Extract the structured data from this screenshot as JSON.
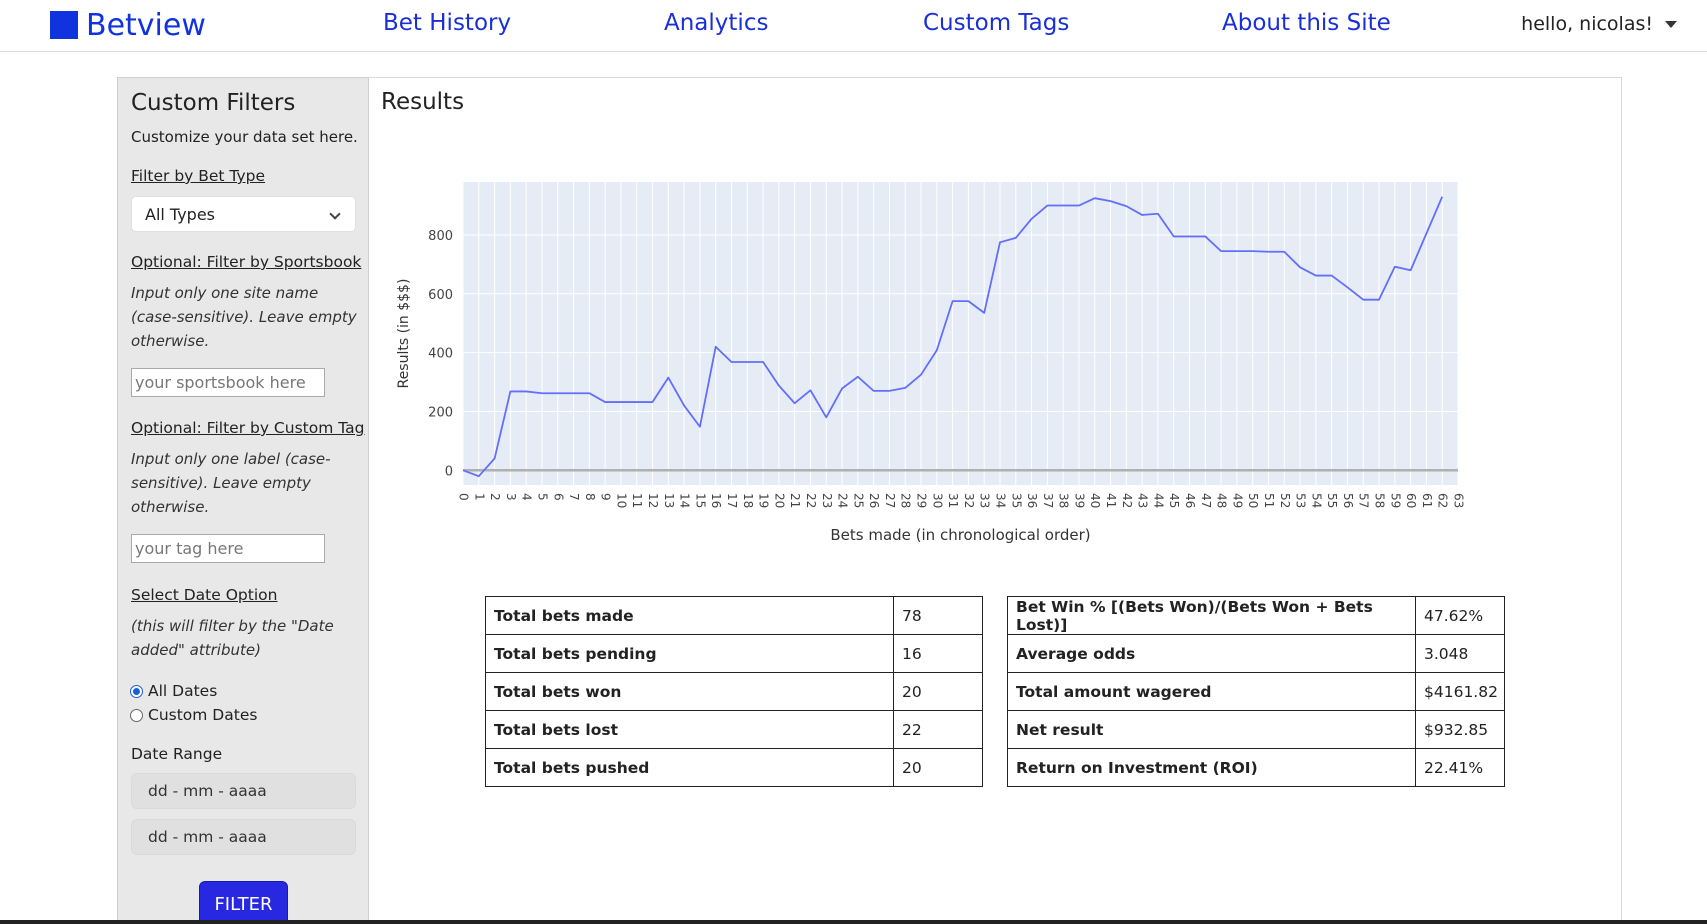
{
  "navbar": {
    "brand": "Betview",
    "links": [
      "Bet History",
      "Analytics",
      "Custom Tags",
      "About this Site"
    ],
    "user": "hello, nicolas!",
    "colors": {
      "brand": "#1133dd",
      "link": "#1a2fd6"
    }
  },
  "sidebar": {
    "title": "Custom Filters",
    "subtitle": "Customize your data set here.",
    "bet_type_label": "Filter by Bet Type",
    "bet_type_value": "All Types",
    "sportsbook_label": "Optional: Filter by Sportsbook",
    "sportsbook_help": "Input only one site name (case-sensitive). Leave empty otherwise.",
    "sportsbook_placeholder": "your sportsbook here",
    "tag_label": "Optional: Filter by Custom Tag",
    "tag_help": "Input only one label (case-sensitive). Leave empty otherwise.",
    "tag_placeholder": "your tag here",
    "date_label": "Select Date Option",
    "date_help": "(this will filter by the \"Date added\" attribute)",
    "radio_all": "All Dates",
    "radio_custom": "Custom Dates",
    "selected_radio": "All Dates",
    "date_range_label": "Date Range",
    "date_from": "dd - mm - aaaa",
    "date_to": "dd - mm - aaaa",
    "filter_button": "FILTER"
  },
  "results": {
    "title": "Results"
  },
  "chart_data": {
    "type": "line",
    "title": "",
    "xlabel": "Bets made (in chronological order)",
    "ylabel": "Results (in $$$)",
    "xlim": [
      0,
      63
    ],
    "ylim": [
      -50,
      980
    ],
    "yticks": [
      0,
      200,
      400,
      600,
      800
    ],
    "grid": true,
    "line_color": "#636efa",
    "plot_bg": "#e5ecf6",
    "x": [
      0,
      1,
      2,
      3,
      4,
      5,
      6,
      7,
      8,
      9,
      10,
      11,
      12,
      13,
      14,
      15,
      16,
      17,
      18,
      19,
      20,
      21,
      22,
      23,
      24,
      25,
      26,
      27,
      28,
      29,
      30,
      31,
      32,
      33,
      34,
      35,
      36,
      37,
      38,
      39,
      40,
      41,
      42,
      43,
      44,
      45,
      46,
      47,
      48,
      49,
      50,
      51,
      52,
      53,
      54,
      55,
      56,
      57,
      58,
      59,
      60,
      61,
      62
    ],
    "y": [
      0,
      -20,
      40,
      268,
      268,
      262,
      262,
      262,
      262,
      232,
      232,
      232,
      232,
      315,
      220,
      148,
      420,
      368,
      368,
      368,
      288,
      228,
      272,
      180,
      278,
      318,
      270,
      270,
      280,
      325,
      408,
      575,
      575,
      535,
      775,
      790,
      855,
      900,
      900,
      900,
      925,
      915,
      898,
      868,
      872,
      795,
      795,
      795,
      745,
      745,
      745,
      743,
      743,
      690,
      662,
      662,
      622,
      580,
      580,
      692,
      680,
      805,
      930
    ]
  },
  "stats_left": [
    {
      "label": "Total bets made",
      "value": "78"
    },
    {
      "label": "Total bets pending",
      "value": "16"
    },
    {
      "label": "Total bets won",
      "value": "20"
    },
    {
      "label": "Total bets lost",
      "value": "22"
    },
    {
      "label": "Total bets pushed",
      "value": "20"
    }
  ],
  "stats_right": [
    {
      "label": "Bet Win % [(Bets Won)/(Bets Won + Bets Lost)]",
      "value": "47.62%"
    },
    {
      "label": "Average odds",
      "value": "3.048"
    },
    {
      "label": "Total amount wagered",
      "value": "$4161.82"
    },
    {
      "label": "Net result",
      "value": "$932.85"
    },
    {
      "label": "Return on Investment (ROI)",
      "value": "22.41%"
    }
  ]
}
